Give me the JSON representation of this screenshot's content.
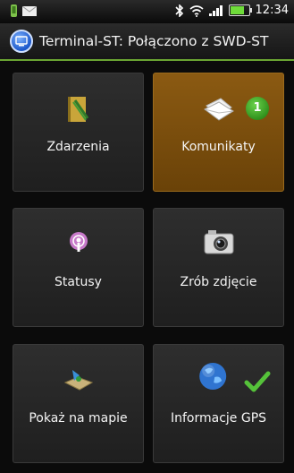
{
  "status_bar": {
    "time": "12:34",
    "battery_level": 0.7,
    "icons": [
      "notification-icon",
      "message-icon",
      "bluetooth-icon",
      "wifi-icon",
      "signal-icon",
      "battery-icon"
    ]
  },
  "title_bar": {
    "title": "Terminal-ST: Połączono z SWD-ST",
    "icon": "terminal-app-icon",
    "accent_color": "#6aa532"
  },
  "tiles": [
    {
      "label": "Zdarzenia",
      "icon": "notebook-icon"
    },
    {
      "label": "Komunikaty",
      "icon": "envelope-icon",
      "badge": "1",
      "selected": true,
      "selected_color": "#7a4d0e"
    },
    {
      "label": "Statusy",
      "icon": "podcast-icon"
    },
    {
      "label": "Zrób zdjęcie",
      "icon": "camera-icon"
    },
    {
      "label": "Pokaż na mapie",
      "icon": "map-icon"
    },
    {
      "label": "Informacje GPS",
      "icon": "globe-icon",
      "status_icon": "checkmark-icon"
    }
  ]
}
